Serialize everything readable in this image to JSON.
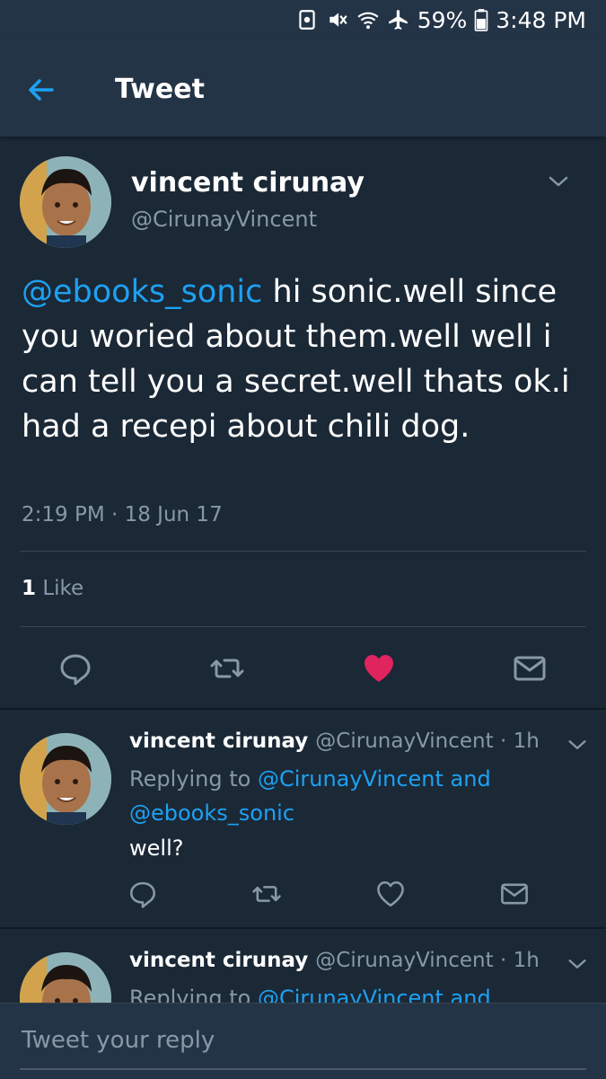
{
  "status_bar": {
    "battery": "59%",
    "time": "3:48 PM"
  },
  "header": {
    "title": "Tweet"
  },
  "tweet": {
    "author_name": "vincent cirunay",
    "author_handle": "@CirunayVincent",
    "mention": "@ebooks_sonic",
    "body": " hi sonic.well since you woried about them.well well i can tell you a secret.well thats ok.i had a recepi about chili dog.",
    "timestamp": "2:19 PM · 18 Jun 17",
    "like_count": "1",
    "like_label": " Like"
  },
  "replies": [
    {
      "author_name": "vincent cirunay",
      "meta": "@CirunayVincent · 1h",
      "replying_prefix": "Replying to ",
      "replying_to": "@CirunayVincent and @ebooks_sonic",
      "body": "well?"
    },
    {
      "author_name": "vincent cirunay",
      "meta": "@CirunayVincent · 1h",
      "replying_prefix": "Replying to ",
      "replying_to": "@CirunayVincent and"
    }
  ],
  "composer": {
    "placeholder": "Tweet your reply"
  },
  "colors": {
    "background": "#1b2836",
    "bar": "#243447",
    "accent": "#1da1f2",
    "secondary_text": "#8899a6",
    "like": "#e0245e"
  },
  "icons": [
    "back-arrow-icon",
    "reply-icon",
    "retweet-icon",
    "heart-icon",
    "direct-message-icon",
    "chevron-down-icon",
    "wifi-icon",
    "airplane-icon",
    "battery-icon",
    "mute-icon"
  ]
}
